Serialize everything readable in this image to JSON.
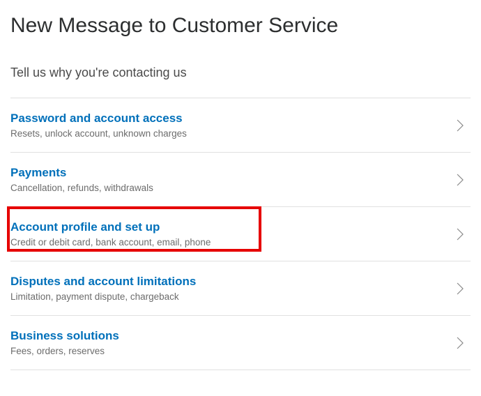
{
  "page_title": "New Message to Customer Service",
  "subtitle": "Tell us why you're contacting us",
  "categories": [
    {
      "title": "Password and account access",
      "desc": "Resets, unlock account, unknown charges",
      "highlighted": false
    },
    {
      "title": "Payments",
      "desc": "Cancellation, refunds, withdrawals",
      "highlighted": false
    },
    {
      "title": "Account profile and set up",
      "desc": "Credit or debit card, bank account, email, phone",
      "highlighted": true
    },
    {
      "title": "Disputes and account limitations",
      "desc": "Limitation, payment dispute, chargeback",
      "highlighted": false
    },
    {
      "title": "Business solutions",
      "desc": "Fees, orders, reserves",
      "highlighted": false
    }
  ]
}
